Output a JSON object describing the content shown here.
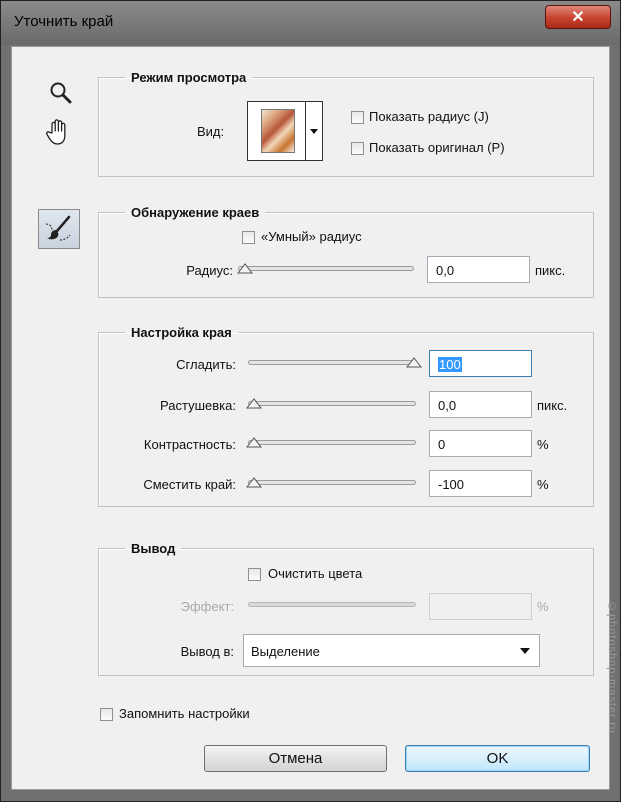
{
  "window": {
    "title": "Уточнить край",
    "close_label": "✕"
  },
  "tools": [
    "zoom-icon",
    "hand-icon",
    "refine-radius-brush-icon"
  ],
  "view_mode": {
    "legend": "Режим просмотра",
    "view_label": "Вид:",
    "show_radius_label": "Показать радиус (J)",
    "show_radius_checked": false,
    "show_original_label": "Показать оригинал (P)",
    "show_original_checked": false
  },
  "edge_detection": {
    "legend": "Обнаружение краев",
    "smart_radius_label": "«Умный» радиус",
    "smart_radius_checked": false,
    "radius_label": "Радиус:",
    "radius_value": "0,0",
    "radius_slider": 0,
    "radius_unit": "пикс."
  },
  "edge_adjust": {
    "legend": "Настройка края",
    "smooth_label": "Сгладить:",
    "smooth_value": "100",
    "smooth_slider": 1,
    "feather_label": "Растушевка:",
    "feather_value": "0,0",
    "feather_slider": 0,
    "feather_unit": "пикс.",
    "contrast_label": "Контрастность:",
    "contrast_value": "0",
    "contrast_slider": 0,
    "contrast_unit": "%",
    "shift_label": "Сместить край:",
    "shift_value": "-100",
    "shift_slider": 0,
    "shift_unit": "%"
  },
  "output": {
    "legend": "Вывод",
    "decontaminate_label": "Очистить цвета",
    "decontaminate_checked": false,
    "amount_label": "Эффект:",
    "amount_value": "",
    "amount_unit": "%",
    "output_to_label": "Вывод в:",
    "output_to_value": "Выделение"
  },
  "remember_label": "Запомнить настройки",
  "remember_checked": false,
  "buttons": {
    "cancel": "Отмена",
    "ok": "OK"
  },
  "watermark": "©photoshop-master.ru"
}
